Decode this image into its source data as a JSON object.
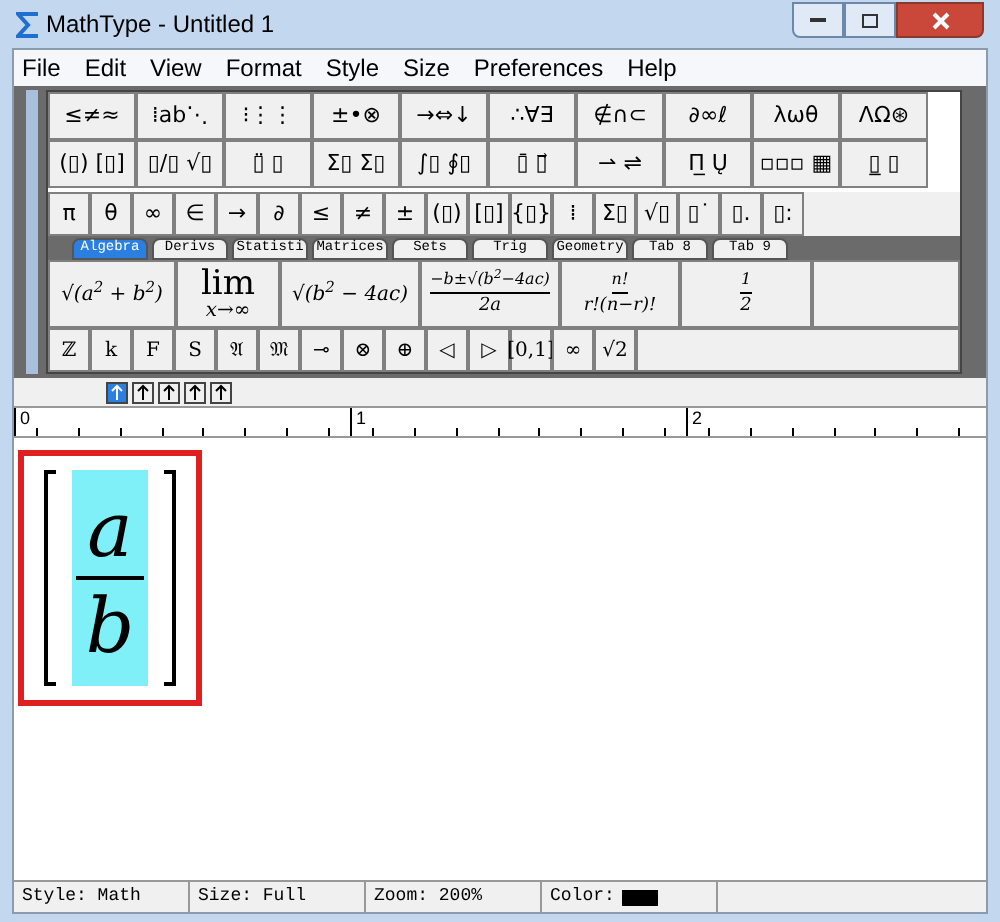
{
  "window": {
    "title": "MathType - Untitled 1"
  },
  "menu": [
    "File",
    "Edit",
    "View",
    "Format",
    "Style",
    "Size",
    "Preferences",
    "Help"
  ],
  "palette_row_1": [
    "≤≠≈",
    "⁞ab⋱",
    "⁝⋮⋮",
    "±•⊗",
    "→⇔↓",
    "∴∀∃",
    "∉∩⊂",
    "∂∞ℓ",
    "λωθ",
    "ΛΩ⊛"
  ],
  "palette_row_2": [
    "(▯) [▯]",
    "▯/▯ √▯",
    "▯̈ ▯",
    "Σ▯ Σ▯",
    "∫▯ ∮▯",
    "▯̄ ▯⃗",
    "⇀ ⇌",
    "Π̲ Ų",
    "▫▫▫ ▦",
    "▯̲ ▯"
  ],
  "symbol_bar": [
    "π",
    "θ",
    "∞",
    "∈",
    "→",
    "∂",
    "≤",
    "≠",
    "±",
    "(▯)",
    "[▯]",
    "{▯}",
    "⁞",
    "Σ▯",
    "√▯",
    "▯˙",
    "▯.",
    "▯:"
  ],
  "tabs": [
    {
      "label": "Algebra",
      "selected": true
    },
    {
      "label": "Derivs",
      "selected": false
    },
    {
      "label": "Statisti",
      "selected": false
    },
    {
      "label": "Matrices",
      "selected": false
    },
    {
      "label": "Sets",
      "selected": false
    },
    {
      "label": "Trig",
      "selected": false
    },
    {
      "label": "Geometry",
      "selected": false
    },
    {
      "label": "Tab 8",
      "selected": false
    },
    {
      "label": "Tab 9",
      "selected": false
    }
  ],
  "templates": [
    {
      "kind": "text",
      "text": "√(a$^{2}$ + b$^{2}$)"
    },
    {
      "kind": "limit",
      "top": "lim",
      "bottom": "x→∞"
    },
    {
      "kind": "text",
      "text": "√(b$^{2}$ − 4ac)"
    },
    {
      "kind": "fraction",
      "numerator": "−b±√(b$^{2}$−4ac)",
      "denominator": "2a"
    },
    {
      "kind": "fraction",
      "numerator": "n!",
      "denominator": "r!(n−r)!"
    },
    {
      "kind": "fraction",
      "numerator": "1",
      "denominator": "2"
    }
  ],
  "small_bar": [
    "ℤ",
    "k",
    "F",
    "S",
    "𝔄",
    "𝔐",
    "⊸",
    "⊗",
    "⊕",
    "◁",
    "▷",
    "[0,1]",
    "∞",
    "√2"
  ],
  "alignment_buttons": [
    {
      "selected": true
    },
    {
      "selected": false
    },
    {
      "selected": false
    },
    {
      "selected": false
    },
    {
      "selected": false
    }
  ],
  "ruler": [
    "0",
    "1",
    "2"
  ],
  "equation": {
    "numerator": "a",
    "denominator": "b",
    "selected": true,
    "outlined": true
  },
  "status_bar": [
    "Style: Math",
    "Size: Full",
    "Zoom: 200%",
    "Color:"
  ]
}
